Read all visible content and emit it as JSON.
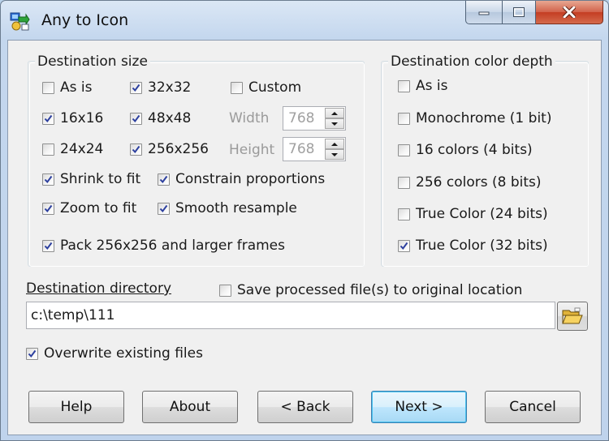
{
  "window": {
    "title": "Any to Icon",
    "controls": {
      "minimize_icon": "minimize-icon",
      "maximize_icon": "maximize-icon",
      "close_icon": "close-icon"
    }
  },
  "destination_size": {
    "legend": "Destination size",
    "as_is": {
      "label": "As is",
      "checked": false
    },
    "s32": {
      "label": "32x32",
      "checked": true
    },
    "custom": {
      "label": "Custom",
      "checked": false
    },
    "s16": {
      "label": "16x16",
      "checked": true
    },
    "s48": {
      "label": "48x48",
      "checked": true
    },
    "width_label": "Width",
    "width_value": "768",
    "s24": {
      "label": "24x24",
      "checked": false
    },
    "s256": {
      "label": "256x256",
      "checked": true
    },
    "height_label": "Height",
    "height_value": "768",
    "shrink": {
      "label": "Shrink to fit",
      "checked": true
    },
    "constrain": {
      "label": "Constrain proportions",
      "checked": true
    },
    "zoom": {
      "label": "Zoom to fit",
      "checked": true
    },
    "smooth": {
      "label": "Smooth resample",
      "checked": true
    },
    "pack": {
      "label": "Pack 256x256 and larger frames",
      "checked": true
    }
  },
  "color_depth": {
    "legend": "Destination color depth",
    "as_is": {
      "label": "As is",
      "checked": false
    },
    "mono": {
      "label": "Monochrome (1 bit)",
      "checked": false
    },
    "c16": {
      "label": "16 colors (4 bits)",
      "checked": false
    },
    "c256": {
      "label": "256 colors (8 bits)",
      "checked": false
    },
    "tc24": {
      "label": "True Color (24 bits)",
      "checked": false
    },
    "tc32": {
      "label": "True Color (32 bits)",
      "checked": true
    }
  },
  "destination": {
    "label": "Destination directory",
    "save_original": {
      "label": "Save processed file(s) to original location",
      "checked": false
    },
    "path": "c:\\temp\\111",
    "browse_icon": "folder-open-icon"
  },
  "overwrite": {
    "label": "Overwrite existing files",
    "checked": true
  },
  "buttons": {
    "help": "Help",
    "about": "About",
    "back": "< Back",
    "next": "Next >",
    "cancel": "Cancel"
  },
  "colors": {
    "accent": "#3c7fb1",
    "check_mark": "#2c3f9e",
    "close_button": "#c43d22"
  }
}
